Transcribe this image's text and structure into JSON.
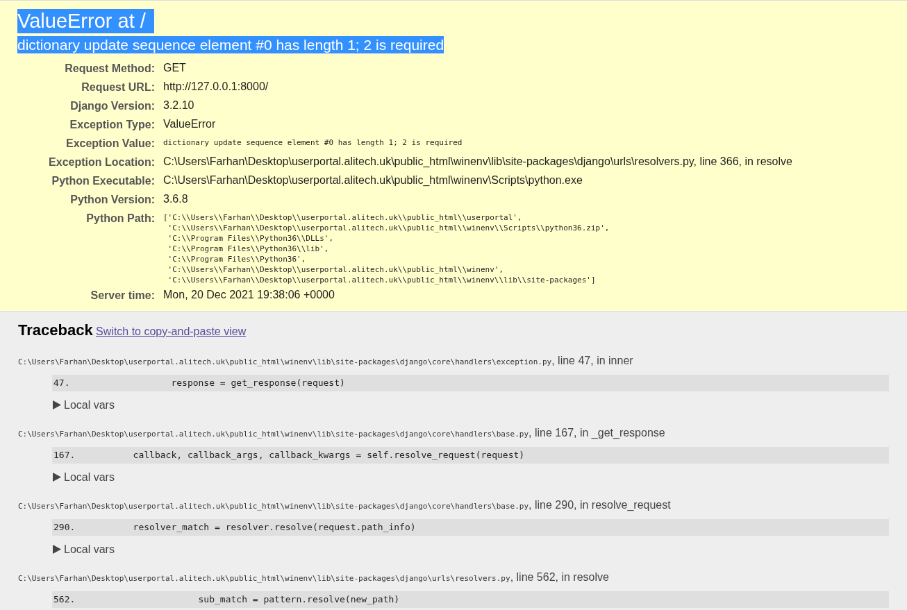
{
  "summary": {
    "title": "ValueError at /",
    "title_highlighted": true,
    "message": "dictionary update sequence element #0 has length 1; 2 is required",
    "message_highlighted": true,
    "meta": [
      {
        "label": "Request Method:",
        "value": "GET",
        "kind": "text"
      },
      {
        "label": "Request URL:",
        "value": "http://127.0.0.1:8000/",
        "kind": "text"
      },
      {
        "label": "Django Version:",
        "value": "3.2.10",
        "kind": "text"
      },
      {
        "label": "Exception Type:",
        "value": "ValueError",
        "kind": "text"
      },
      {
        "label": "Exception Value:",
        "value": "dictionary update sequence element #0 has length 1; 2 is required",
        "kind": "code"
      },
      {
        "label": "Exception Location:",
        "value": "C:\\Users\\Farhan\\Desktop\\userportal.alitech.uk\\public_html\\winenv\\lib\\site-packages\\django\\urls\\resolvers.py, line 366, in resolve",
        "kind": "text"
      },
      {
        "label": "Python Executable:",
        "value": "C:\\Users\\Farhan\\Desktop\\userportal.alitech.uk\\public_html\\winenv\\Scripts\\python.exe",
        "kind": "text"
      },
      {
        "label": "Python Version:",
        "value": "3.6.8",
        "kind": "text"
      },
      {
        "label": "Python Path:",
        "value": "['C:\\\\Users\\\\Farhan\\\\Desktop\\\\userportal.alitech.uk\\\\public_html\\\\userportal',\n 'C:\\\\Users\\\\Farhan\\\\Desktop\\\\userportal.alitech.uk\\\\public_html\\\\winenv\\\\Scripts\\\\python36.zip',\n 'C:\\\\Program Files\\\\Python36\\\\DLLs',\n 'C:\\\\Program Files\\\\Python36\\\\lib',\n 'C:\\\\Program Files\\\\Python36',\n 'C:\\\\Users\\\\Farhan\\\\Desktop\\\\userportal.alitech.uk\\\\public_html\\\\winenv',\n 'C:\\\\Users\\\\Farhan\\\\Desktop\\\\userportal.alitech.uk\\\\public_html\\\\winenv\\\\lib\\\\site-packages']",
        "kind": "code"
      },
      {
        "label": "Server time:",
        "value": "Mon, 20 Dec 2021 19:38:06 +0000",
        "kind": "text"
      }
    ]
  },
  "traceback": {
    "title": "Traceback",
    "switch_link": "Switch to copy-and-paste view",
    "frames": [
      {
        "file": "C:\\Users\\Farhan\\Desktop\\userportal.alitech.uk\\public_html\\winenv\\lib\\site-packages\\django\\core\\handlers\\exception.py",
        "location": ", line 47, in inner",
        "line_number": "47.",
        "code": "               response = get_response(request)",
        "local_vars": {
          "label": "Local vars",
          "expanded": false
        }
      },
      {
        "file": "C:\\Users\\Farhan\\Desktop\\userportal.alitech.uk\\public_html\\winenv\\lib\\site-packages\\django\\core\\handlers\\base.py",
        "location": ", line 167, in _get_response",
        "line_number": "167.",
        "code": "        callback, callback_args, callback_kwargs = self.resolve_request(request)",
        "local_vars": {
          "label": "Local vars",
          "expanded": false
        }
      },
      {
        "file": "C:\\Users\\Farhan\\Desktop\\userportal.alitech.uk\\public_html\\winenv\\lib\\site-packages\\django\\core\\handlers\\base.py",
        "location": ", line 290, in resolve_request",
        "line_number": "290.",
        "code": "        resolver_match = resolver.resolve(request.path_info)",
        "local_vars": {
          "label": "Local vars",
          "expanded": false
        }
      },
      {
        "file": "C:\\Users\\Farhan\\Desktop\\userportal.alitech.uk\\public_html\\winenv\\lib\\site-packages\\django\\urls\\resolvers.py",
        "location": ", line 562, in resolve",
        "line_number": "562.",
        "code": "                    sub_match = pattern.resolve(new_path)"
      }
    ]
  }
}
